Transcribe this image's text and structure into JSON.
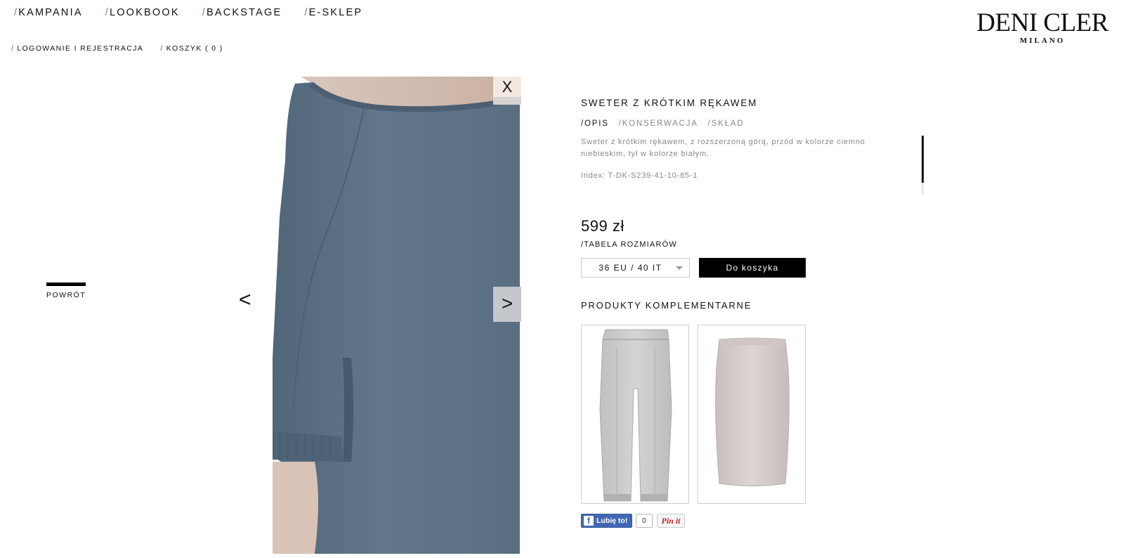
{
  "nav": {
    "items": [
      {
        "slash": "/",
        "label": "KAMPANIA"
      },
      {
        "slash": "/",
        "label": "LOOKBOOK"
      },
      {
        "slash": "/",
        "label": "BACKSTAGE"
      },
      {
        "slash": "/",
        "label": "E-SKLEP"
      }
    ]
  },
  "subnav": {
    "login": {
      "slash": "/",
      "label": "LOGOWANIE I REJESTRACJA"
    },
    "cart": {
      "slash": "/",
      "label": "KOSZYK ( 0 )"
    }
  },
  "logo": {
    "line1": "DENI CLER",
    "line2": "MILANO"
  },
  "back": {
    "label": "POWRÓT"
  },
  "gallery": {
    "prev": "<",
    "next": ">",
    "close": "X"
  },
  "product": {
    "title": "SWETER Z KRÓTKIM RĘKAWEM",
    "tabs": [
      {
        "slash": "/",
        "label": "OPIS"
      },
      {
        "slash": "/",
        "label": "KONSERWACJA"
      },
      {
        "slash": "/",
        "label": "SKŁAD"
      }
    ],
    "description": "Sweter z krótkim rękawem, z rozszerzoną górą, przód w kolorze ciemno niebieskim, tył w kolorze białym.",
    "index": "Index: T-DK-S239-41-10-85-1",
    "price": "599 zł",
    "size_table": "/TABELA ROZMIARÓW",
    "size_selected": "36 EU / 40 IT",
    "add_to_cart": "Do koszyka"
  },
  "complementary": {
    "title": "PRODUKTY KOMPLEMENTARNE"
  },
  "social": {
    "fb_like": "Lubię to!",
    "fb_icon": "f",
    "fb_count": "0",
    "pin": "Pin it"
  },
  "colors": {
    "sweater": "#5f7387",
    "accent": "#000000",
    "muted_text": "#888888"
  }
}
